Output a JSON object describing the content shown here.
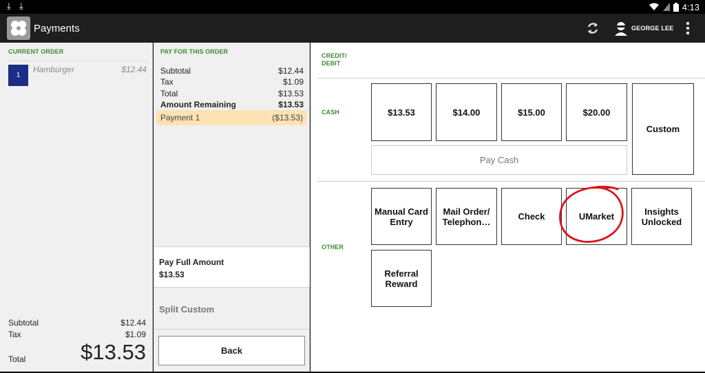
{
  "app": {
    "title": "Payments",
    "time": "4:13",
    "user_name": "GEORGE LEE"
  },
  "colors": {
    "accent_green": "#3b8a2f",
    "qty_blue": "#1b2d85",
    "payment_highlight": "#fde2b4",
    "annotation_red": "#e0101a"
  },
  "current_order": {
    "label": "CURRENT ORDER",
    "items": [
      {
        "qty": "1",
        "name": "Hamburger",
        "price": "$12.44"
      }
    ],
    "subtotal_label": "Subtotal",
    "subtotal": "$12.44",
    "tax_label": "Tax",
    "tax": "$1.09",
    "total_label": "Total",
    "total": "$13.53"
  },
  "pay_for_order": {
    "label": "PAY FOR THIS ORDER",
    "subtotal_label": "Subtotal",
    "subtotal": "$12.44",
    "tax_label": "Tax",
    "tax": "$1.09",
    "total_label": "Total",
    "total": "$13.53",
    "remaining_label": "Amount Remaining",
    "remaining": "$13.53",
    "payment_label": "Payment 1",
    "payment_amount": "($13.53)",
    "pay_full_label": "Pay Full Amount",
    "pay_full_amount": "$13.53",
    "split_custom_label": "Split Custom",
    "back_label": "Back"
  },
  "tenders": {
    "credit_label": "CREDIT/\nDEBIT",
    "cash_label": "CASH",
    "other_label": "OTHER",
    "cash_amounts": [
      "$13.53",
      "$14.00",
      "$15.00",
      "$20.00"
    ],
    "custom_label": "Custom",
    "pay_cash_label": "Pay Cash",
    "other_options": [
      "Manual Card Entry",
      "Mail Order/ Telephon…",
      "Check",
      "UMarket",
      "Insights Unlocked",
      "Referral Reward"
    ]
  },
  "icons": {
    "app_logo": "clover-logo-icon",
    "refresh": "refresh-icon",
    "user": "user-avatar-icon",
    "overflow": "overflow-menu-icon",
    "download": "download-icon",
    "wifi": "wifi-icon",
    "battery": "battery-icon"
  }
}
